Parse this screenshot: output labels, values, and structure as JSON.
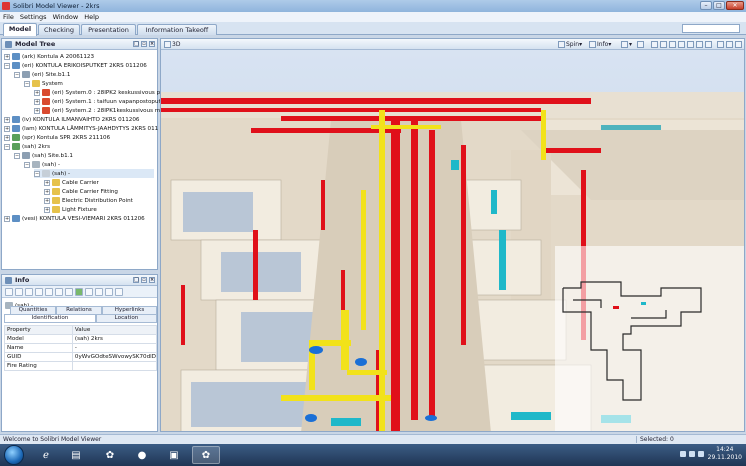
{
  "window": {
    "title": "Solibri Model Viewer - 2krs"
  },
  "menu": [
    "File",
    "Settings",
    "Window",
    "Help"
  ],
  "main_tabs": [
    "Model",
    "Checking",
    "Presentation",
    "Information Takeoff"
  ],
  "model_tree": {
    "title": "Model Tree",
    "rows": [
      "(ark) Kontula A 20061123",
      "(eri) KONTULA ERIKOISPUTKET 2KRS 011206",
      "(eri) Site.b1.1",
      "System",
      "(eri) System.0 : 28IPK2 keskussivous pui",
      "(eri) System.1 : taifuun vapanpostoputki",
      "(eri) System.2 : 28IPK1keskussivous maj",
      "(iv) KONTULA ILMANVAIHTO 2KRS 011206",
      "(lam) KONTULA LÄMMITYS-JAAHDYTYS 2KRS 011",
      "(spr) Kontula SPR 2KRS 211106",
      "(sah) 2krs",
      "(sah) Site.b1.1",
      "(sah) -",
      "(sah) -",
      "Cable Carrier",
      "Cable Carrier Fitting",
      "Electric Distribution Point",
      "Light Fixture",
      "(vesi) KONTULA VESI-VIEMARI 2KRS 011206"
    ]
  },
  "info": {
    "title": "Info",
    "selection": "(sah) -",
    "tabs_top": [
      "Quantities",
      "Relations",
      "Hyperlinks"
    ],
    "tabs_bottom": [
      "Identification",
      "Location"
    ],
    "columns": [
      "Property",
      "Value"
    ],
    "properties": [
      [
        "Model",
        "(sah) 2krs"
      ],
      [
        "Name",
        "-"
      ],
      [
        "GUID",
        "0yWvGOdteSWvowySK70dlD"
      ],
      [
        "Fire Rating",
        ""
      ]
    ]
  },
  "view3d": {
    "title": "3D",
    "spin_label": "Spin",
    "info_label": "Info"
  },
  "status": {
    "welcome": "Welcome to Solibri Model Viewer",
    "selected": "Selected: 0"
  },
  "clock": {
    "time": "14:24",
    "date": "29.11.2010"
  },
  "colors": {
    "duct_red": "#e0101a",
    "pipe_yellow": "#f2e21a",
    "cyan_tray": "#1fb8c9",
    "floor_beige": "#e3d9c8"
  }
}
